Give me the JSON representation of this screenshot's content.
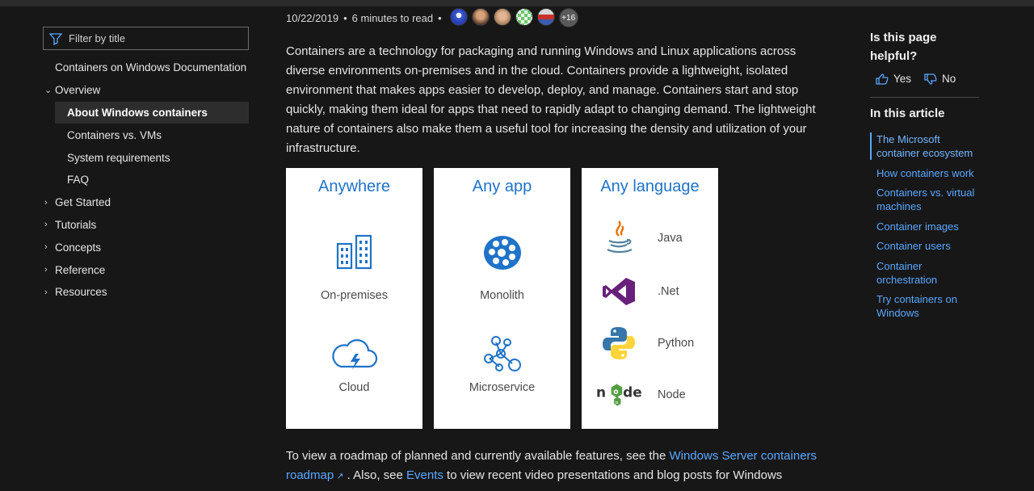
{
  "filter": {
    "placeholder": "Filter by title"
  },
  "nav": {
    "top_link": "Containers on Windows Documentation",
    "overview": "Overview",
    "overview_children": [
      "About Windows containers",
      "Containers vs. VMs",
      "System requirements",
      "FAQ"
    ],
    "sections": [
      "Get Started",
      "Tutorials",
      "Concepts",
      "Reference",
      "Resources"
    ]
  },
  "meta": {
    "date": "10/22/2019",
    "separator": "•",
    "read_time": "6 minutes to read",
    "more_contributors": "+16"
  },
  "intro": "Containers are a technology for packaging and running Windows and Linux applications across diverse environments on-premises and in the cloud. Containers provide a lightweight, isolated environment that makes apps easier to develop, deploy, and manage. Containers start and stop quickly, making them ideal for apps that need to rapidly adapt to changing demand. The lightweight nature of containers also make them a useful tool for increasing the density and utilization of your infrastructure.",
  "cards": {
    "anywhere": {
      "title": "Anywhere",
      "items": [
        "On-premises",
        "Cloud"
      ]
    },
    "any_app": {
      "title": "Any app",
      "items": [
        "Monolith",
        "Microservice"
      ]
    },
    "any_language": {
      "title": "Any language",
      "items": [
        "Java",
        ".Net",
        "Python",
        "Node"
      ]
    }
  },
  "outro": {
    "text1": "To view a roadmap of planned and currently available features, see the ",
    "link1": "Windows Server containers roadmap",
    "text2": " . Also, see ",
    "link2": "Events",
    "text3": " to view recent video presentations and blog posts for Windows"
  },
  "rail": {
    "helpful": "Is this page helpful?",
    "yes": "Yes",
    "no": "No",
    "toc_title": "In this article",
    "toc": [
      "The Microsoft container ecosystem",
      "How containers work",
      "Containers vs. virtual machines",
      "Container images",
      "Container users",
      "Container orchestration",
      "Try containers on Windows"
    ]
  },
  "colors": {
    "accent": "#59a8ff",
    "card_title": "#1f73c8",
    "background": "#171717"
  }
}
